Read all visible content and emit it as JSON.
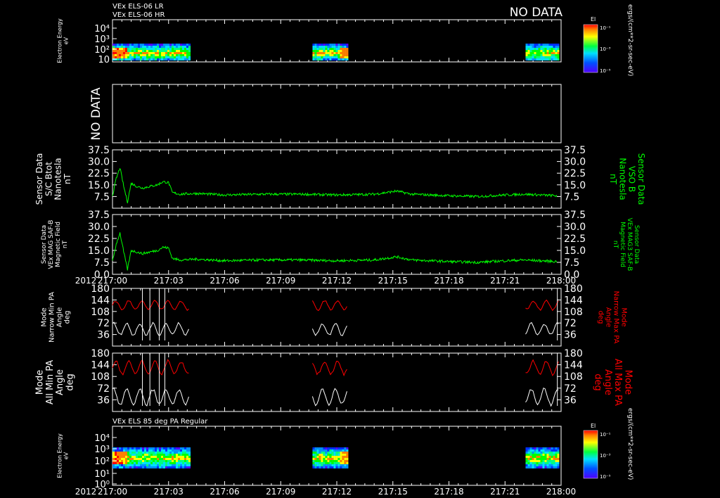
{
  "header": {
    "line1": "VEx ELS-06 LR",
    "line2": "VEx ELS-06 HR",
    "no_data_top": "NO DATA"
  },
  "colors": {
    "background": "#000000",
    "axes": "#ffffff",
    "green": "#00ff00",
    "red": "#ff0000",
    "white": "#ffffff"
  },
  "time_axis": {
    "year_label": "2012",
    "ticks": [
      "217:00",
      "217:03",
      "217:06",
      "217:09",
      "217:12",
      "217:15",
      "217:18",
      "217:21",
      "218:00"
    ],
    "range_min": [
      0,
      24
    ]
  },
  "colorbar_top": {
    "title": "El",
    "ticks": [
      "10⁻¹",
      "10⁻³",
      "10⁻⁵"
    ],
    "units": "ergs/(cm**2-sr-sec-eV)"
  },
  "colorbar_bottom": {
    "title": "El",
    "ticks": [
      "10⁻¹",
      "10⁻³",
      "10⁻⁵"
    ],
    "units": "ergs/(cm**2-sr-sec-eV)"
  },
  "bottom_panel_title": "VEx ELS 85 deg PA Regular",
  "chart_data": [
    {
      "type": "heatmap",
      "ylabel": [
        "Electron Energy",
        "eV"
      ],
      "ytick_labels": [
        "10",
        "10²",
        "10³",
        "10⁴"
      ],
      "data_intervals_min": [
        [
          0,
          4.1
        ],
        [
          10.7,
          12.6
        ],
        [
          22.1,
          23.9
        ]
      ],
      "energy_band_eV": [
        10,
        300
      ],
      "color_scale": "log"
    },
    {
      "type": "line",
      "no_data_label": "NO DATA"
    },
    {
      "type": "line",
      "ylabel_left": [
        "Sensor Data",
        "S/C Btot",
        "Nanotesla",
        "nT"
      ],
      "ylabel_right": [
        "Sensor Data",
        "VSO B",
        "Nanotesla",
        "nT"
      ],
      "ylim": [
        0,
        37.5
      ],
      "ytick_labels": [
        "7.5",
        "15.0",
        "22.5",
        "30.0",
        "37.5"
      ],
      "series": [
        {
          "values_min_nT": [
            [
              0.0,
              8
            ],
            [
              0.2,
              19
            ],
            [
              0.4,
              26
            ],
            [
              0.6,
              14
            ],
            [
              0.8,
              4
            ],
            [
              1.0,
              16
            ],
            [
              1.3,
              14
            ],
            [
              1.6,
              13
            ],
            [
              2.0,
              14
            ],
            [
              2.4,
              15
            ],
            [
              2.7,
              17
            ],
            [
              3.0,
              16.5
            ],
            [
              3.2,
              10
            ],
            [
              3.6,
              9
            ],
            [
              4.5,
              9.5
            ],
            [
              6,
              8.5
            ],
            [
              8,
              9
            ],
            [
              10,
              9
            ],
            [
              12,
              8.5
            ],
            [
              14,
              9
            ],
            [
              15.2,
              11
            ],
            [
              16,
              9
            ],
            [
              18,
              8
            ],
            [
              19.5,
              7.5
            ],
            [
              21,
              8.5
            ],
            [
              22,
              9
            ],
            [
              23.8,
              8
            ]
          ]
        }
      ]
    },
    {
      "type": "line",
      "ylabel_left": [
        "Sensor Data",
        "VEx MAG SAF-B",
        "Magnetic Field",
        "nT"
      ],
      "ylabel_right": [
        "Sensor Data",
        "VEx MAG3 SAF-B",
        "Magnetic Field",
        "nT"
      ],
      "ylim": [
        0,
        37.5
      ],
      "ytick_labels": [
        "0.0",
        "7.5",
        "15.0",
        "22.5",
        "30.0",
        "37.5"
      ],
      "series": [
        {
          "values_min_nT": [
            [
              0.0,
              8
            ],
            [
              0.2,
              19
            ],
            [
              0.4,
              26
            ],
            [
              0.6,
              14
            ],
            [
              0.8,
              3
            ],
            [
              1.0,
              15
            ],
            [
              1.3,
              14
            ],
            [
              1.6,
              13
            ],
            [
              2.0,
              14
            ],
            [
              2.4,
              15
            ],
            [
              2.7,
              17
            ],
            [
              3.0,
              16.5
            ],
            [
              3.2,
              10
            ],
            [
              3.6,
              9
            ],
            [
              4.5,
              9.5
            ],
            [
              6,
              8.5
            ],
            [
              8,
              9
            ],
            [
              10,
              9
            ],
            [
              12,
              8.5
            ],
            [
              14,
              9
            ],
            [
              15.2,
              11
            ],
            [
              16,
              9
            ],
            [
              18,
              8
            ],
            [
              19.5,
              7.5
            ],
            [
              21,
              8.5
            ],
            [
              22,
              9
            ],
            [
              23.8,
              8
            ]
          ]
        }
      ]
    },
    {
      "type": "line",
      "ylabel_left": [
        "Mode",
        "Narrow Min PA",
        "Angle",
        "deg"
      ],
      "ylabel_right": [
        "Mode",
        "Narrow Max PA",
        "Angle",
        "deg"
      ],
      "ylim": [
        0,
        180
      ],
      "ytick_labels": [
        "36",
        "72",
        "108",
        "144",
        "180"
      ],
      "data_intervals_min": [
        [
          0,
          4.1
        ],
        [
          10.7,
          12.6
        ],
        [
          22.1,
          23.9
        ]
      ],
      "series": [
        {
          "name_ref": "max_pa",
          "level_deg": [
            110,
            145
          ]
        },
        {
          "name_ref": "min_pa",
          "level_deg": [
            30,
            75
          ]
        }
      ]
    },
    {
      "type": "line",
      "ylabel_left": [
        "Mode",
        "All Min PA",
        "Angle",
        "deg"
      ],
      "ylabel_right": [
        "Mode",
        "All Max PA",
        "Angle",
        "deg"
      ],
      "ylim": [
        0,
        180
      ],
      "ytick_labels": [
        "36",
        "72",
        "108",
        "144",
        "180"
      ],
      "data_intervals_min": [
        [
          0,
          4.1
        ],
        [
          10.7,
          12.6
        ],
        [
          22.1,
          23.9
        ]
      ],
      "series": [
        {
          "name_ref": "max_pa",
          "level_deg": [
            110,
            160
          ]
        },
        {
          "name_ref": "min_pa",
          "level_deg": [
            15,
            75
          ]
        }
      ]
    },
    {
      "type": "heatmap",
      "ylabel": [
        "Electron Energy",
        "eV"
      ],
      "ytick_labels": [
        "10⁰",
        "10¹",
        "10²",
        "10³",
        "10⁴"
      ],
      "data_intervals_min": [
        [
          0,
          4.1
        ],
        [
          10.7,
          12.6
        ],
        [
          22.1,
          23.9
        ]
      ],
      "energy_band_eV": [
        3,
        300
      ],
      "color_scale": "log"
    }
  ]
}
